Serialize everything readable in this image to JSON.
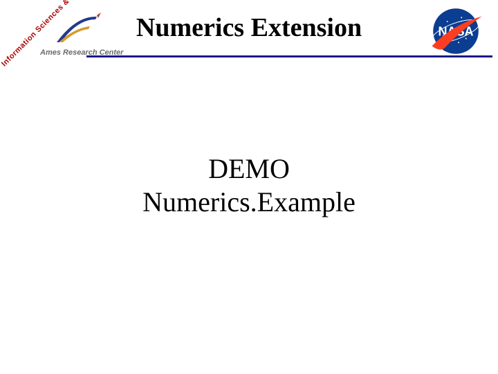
{
  "header": {
    "title": "Numerics Extension",
    "org_subtitle": "Ames Research Center",
    "org_diagonal": "Information Sciences & Technology",
    "nasa_wordmark": "NASA"
  },
  "body": {
    "line1": "DEMO",
    "line2": "Numerics.Example"
  },
  "colors": {
    "rule": "#1a1a8a",
    "nasa_blue": "#0b3d91",
    "nasa_red": "#fc3d21",
    "ames_swoosh_blue": "#233a8c",
    "ames_swoosh_gold": "#d79a2b",
    "diag_red": "#b00000",
    "subtitle_gray": "#6b6b6b"
  }
}
